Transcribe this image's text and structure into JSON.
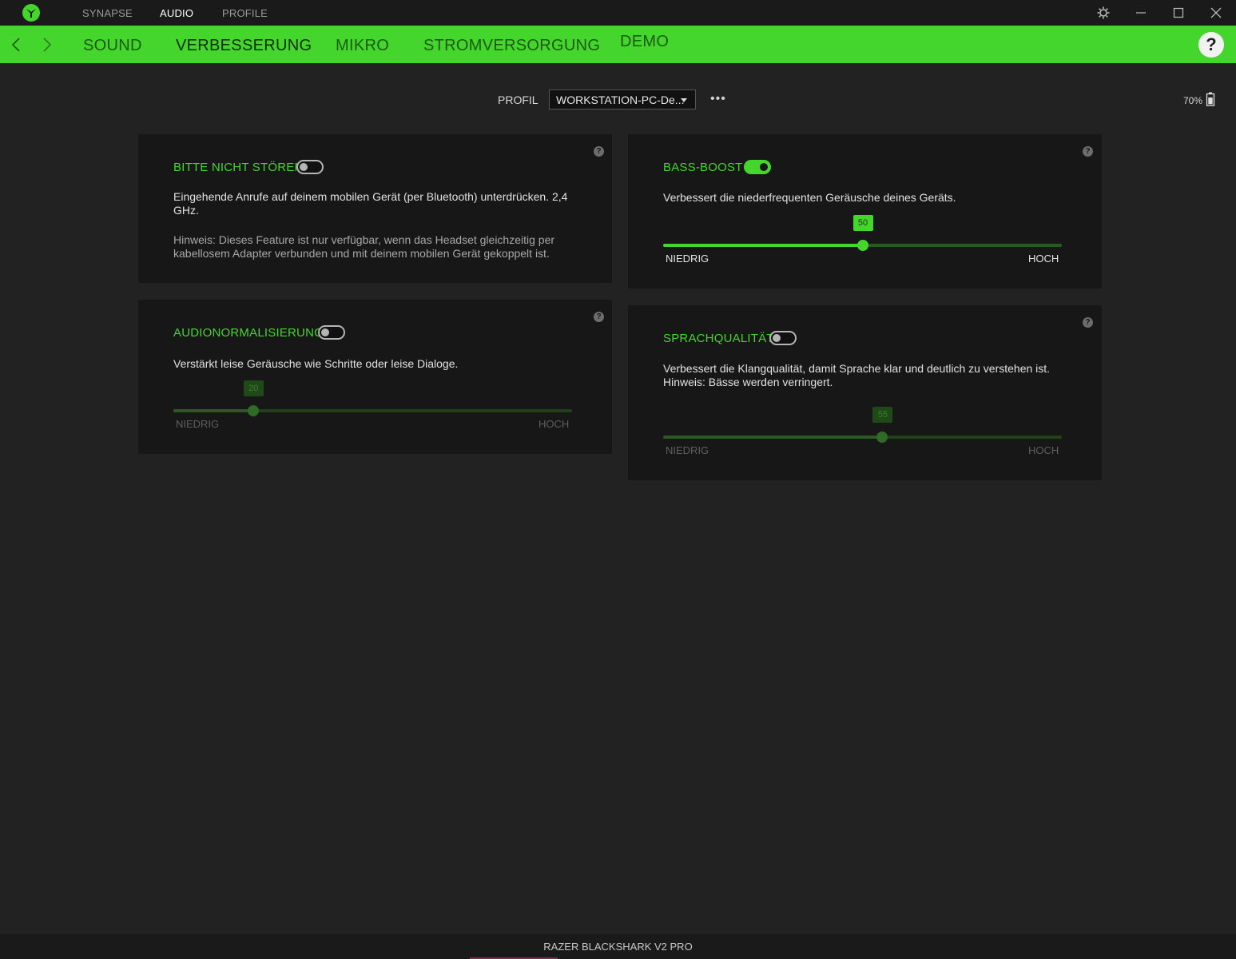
{
  "titlebar": {
    "tabs": [
      "SYNAPSE",
      "AUDIO",
      "PROFILE"
    ],
    "active_tab": "AUDIO"
  },
  "navbar": {
    "tabs": [
      "SOUND",
      "VERBESSERUNG",
      "MIKRO",
      "STROMVERSORGUNG",
      "DEMO"
    ],
    "active_tab": "VERBESSERUNG",
    "help": "?"
  },
  "profile": {
    "label": "PROFIL",
    "value": "WORKSTATION-PC-De...",
    "more": "•••"
  },
  "battery": {
    "percent_text": "70%",
    "level": 0.7
  },
  "cards": {
    "dnd": {
      "title": "BITTE NICHT STÖREN",
      "enabled": false,
      "description": "Eingehende Anrufe auf deinem mobilen Gerät (per Bluetooth) unterdrücken. 2,4 GHz.",
      "note": "Hinweis: Dieses Feature ist nur verfügbar, wenn das Headset gleichzeitig per kabellosem Adapter verbunden und mit deinem mobilen Gerät gekoppelt ist."
    },
    "bass": {
      "title": "BASS-BOOST",
      "enabled": true,
      "description": "Verbessert die niederfrequenten Geräusche deines Geräts.",
      "value": 50,
      "value_text": "50",
      "low": "NIEDRIG",
      "high": "HOCH"
    },
    "normalization": {
      "title": "AUDIONORMALISIERUNG",
      "enabled": false,
      "description": "Verstärkt leise Geräusche wie Schritte oder leise Dialoge.",
      "value": 20,
      "value_text": "20",
      "low": "NIEDRIG",
      "high": "HOCH"
    },
    "voice": {
      "title": "SPRACHQUALITÄT",
      "enabled": false,
      "description": "Verbessert die Klangqualität, damit Sprache klar und deutlich zu verstehen ist.",
      "note": "Hinweis: Bässe werden verringert.",
      "value": 55,
      "value_text": "55",
      "low": "NIEDRIG",
      "high": "HOCH"
    }
  },
  "footer": {
    "device": "RAZER BLACKSHARK V2 PRO"
  },
  "colors": {
    "accent": "#44d62c",
    "background": "#222222",
    "card": "#171717"
  }
}
